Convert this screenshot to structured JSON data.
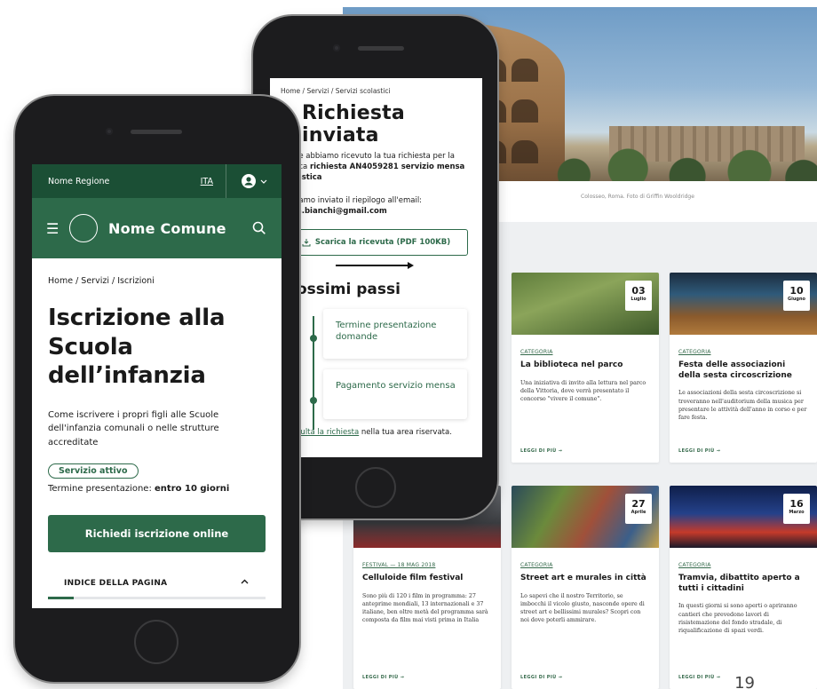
{
  "desktop": {
    "hero_caption": "Colosseo, Roma. Foto di Griffin Wooldridge",
    "page_number": "19",
    "cards": [
      {
        "date_day": "03",
        "date_month": "Luglio",
        "category": "CATEGORIA",
        "title": "La biblioteca nel parco",
        "description": "Una iniziativa di invito alla lettura nel parco della Vittoria, dove verrà presentato il concorso \"vivere il comune\".",
        "more": "LEGGI DI PIÙ →"
      },
      {
        "date_day": "10",
        "date_month": "Giugno",
        "category": "CATEGORIA",
        "title": "Festa delle associazioni della sesta circoscrizione",
        "description": "Le associazioni della sesta circoscrizione si troveranno nell'auditorium della musica per presentare le attività dell'anno in corso e per fare festa.",
        "more": "LEGGI DI PIÙ →"
      },
      {
        "date_day": "",
        "date_month": "",
        "category": "FESTIVAL — 18 MAG 2018",
        "title": "Celluloide film festival",
        "description": "Sono più di 120 i film in programma: 27 anteprime mondiali, 13 internazionali e 37 italiane, ben oltre metà del programma sarà composta da film mai visti prima in Italia",
        "more": "LEGGI DI PIÙ →"
      },
      {
        "date_day": "27",
        "date_month": "Aprile",
        "category": "CATEGORIA",
        "title": "Street art e murales in città",
        "description": "Lo sapevi che il nostro Territorio, se imbocchi il vicolo giusto, nasconde opere di street art e bellissimi murales? Scopri con noi dove poterli ammirare.",
        "more": "LEGGI DI PIÙ →"
      },
      {
        "date_day": "16",
        "date_month": "Marzo",
        "category": "CATEGORIA",
        "title": "Tramvia, dibattito aperto a tutti i cittadini",
        "description": "In questi giorni si sono aperti o apriranno cantieri che prevedono lavori di risistemazione del fondo stradale, di riqualificazione di spazi verdi.",
        "more": "LEGGI DI PIÙ →"
      }
    ]
  },
  "phone2": {
    "breadcrumb": "Home / Servizi / Servizi scolastici",
    "title": "Richiesta inviata",
    "text1_pre": "ie abbiamo ricevuto la tua richiesta per la",
    "text1_mid": "ica ",
    "text1_bold": "richiesta AN4059281 servizio mensa",
    "text1_bold2": "astica",
    "text2": "iamo inviato il riepilogo all'email:",
    "email": "a.bianchi@gmail.com",
    "download_label": "Scarica la ricevuta (PDF 100KB)",
    "steps_title": "ossimi passi",
    "steps": [
      "Termine presentazione domande",
      "Pagamento servizio mensa"
    ],
    "footer_link": "sulta la richiesta",
    "footer_rest": " nella tua area riservata."
  },
  "phone1": {
    "region": "Nome Regione",
    "lang": "ITA",
    "municipality": "Nome Comune",
    "breadcrumb": "Home / Servizi / Iscrizioni",
    "title": "Iscrizione alla Scuola dell’infanzia",
    "description": "Come iscrivere i propri figli alle Scuole dell'infanzia comunali o nelle strutture accreditate",
    "status_badge": "Servizio attivo",
    "term_label": "Termine presentazione: ",
    "term_value": "entro 10 giorni",
    "cta": "Richiedi iscrizione online",
    "index_label": "INDICE DELLA PAGINA",
    "index_progress": 0.12
  },
  "colors": {
    "primary": "#2d6a4a",
    "primary_dark": "#1b4f35",
    "cards_bg": "#eef0f2"
  }
}
